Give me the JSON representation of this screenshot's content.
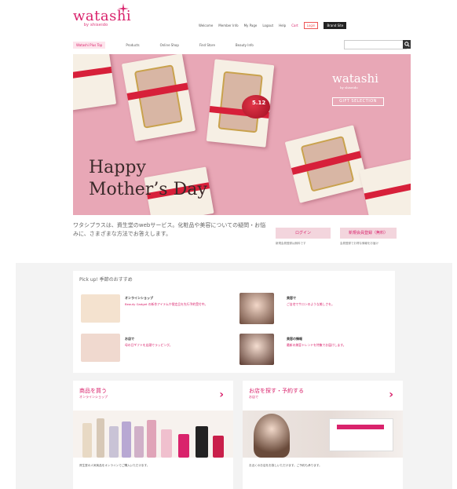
{
  "header": {
    "logo": "watashi",
    "logo_sub": "by shiseido",
    "util_links": [
      "Welcome",
      "Member Info",
      "My Page",
      "Logout",
      "Help"
    ],
    "cart": "Cart",
    "login_link": "Login",
    "mypage_btn": "Brand Site"
  },
  "nav": {
    "items": [
      "Watashi Plus Top",
      "Products",
      "Online Shop",
      "Find Store",
      "Beauty Info"
    ]
  },
  "hero": {
    "logo": "watashi",
    "logo_sub": "by shiseido",
    "gift": "GIFT SELECTION",
    "line1": "Happy",
    "line2": "Mother’s Day",
    "tag": "5.12"
  },
  "intro": {
    "text": "ワタシプラスは、資生堂のwebサービス。化粧品や美容についての疑問・お悩みに、さまざまな方法でお答えします。",
    "login": "ログイン",
    "register": "新規会員登録（無料）",
    "login_note": "新規会員登録は無料です",
    "reg_note": "会員登録でお得な情報をお届け"
  },
  "pickup": {
    "title": "Pick up!  季節のおすすめ",
    "items": [
      {
        "tag": "オンラインショップ",
        "text": "Beauty Gadget の新作アイテムや限定品を先行予約受付中。"
      },
      {
        "tag": "お店で",
        "text": "母の日ギフトを店頭でラッピング。"
      },
      {
        "tag": "美容で",
        "text": "ご自宅でサロンのような美しさを。"
      },
      {
        "tag": "美容の情報",
        "text": "最新の美容トレンドを特集でお届けします。"
      }
    ]
  },
  "cards": [
    {
      "title": "商品を買う",
      "sub": "オンラインショップ",
      "text": "資生堂の人気商品をオンラインでご購入いただけます。"
    },
    {
      "title": "お店を探す・予約する",
      "sub": "お店で",
      "text": "お近くのお店をお探しいただけます。ご予約も承ります。"
    }
  ],
  "colors": {
    "accent": "#d9236c",
    "hero": "#e8a7b6"
  }
}
